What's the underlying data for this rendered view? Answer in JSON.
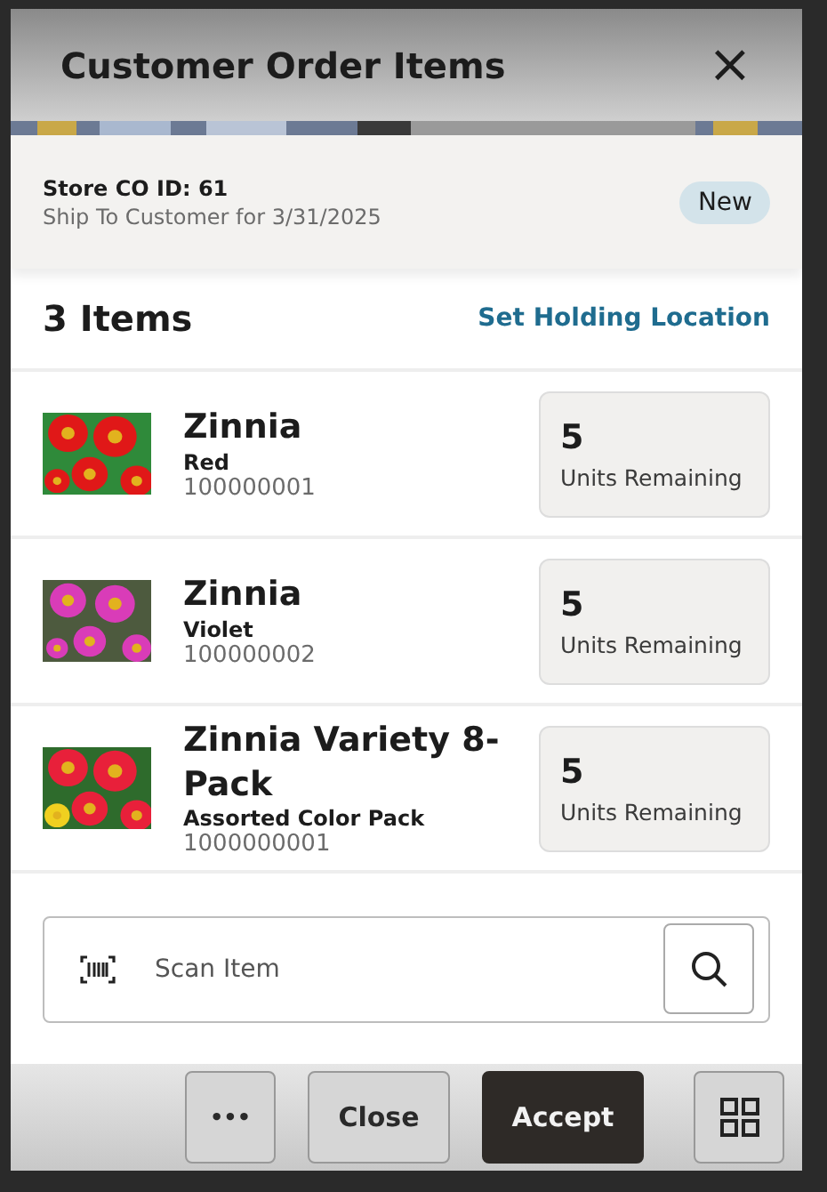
{
  "window": {
    "title": "Customer Order Items",
    "close": "×"
  },
  "order": {
    "id_label": "Store CO ID: 61",
    "subtitle": "Ship To Customer for 3/31/2025",
    "status": "New"
  },
  "items_header": {
    "count": "3 Items",
    "action": "Set Holding Location"
  },
  "items": [
    {
      "name": "Zinnia",
      "variant": "Red",
      "sku": "100000001",
      "quantity": "5",
      "quantity_label": "Units Remaining"
    },
    {
      "name": "Zinnia",
      "variant": "Violet",
      "sku": "100000002",
      "quantity": "5",
      "quantity_label": "Units Remaining"
    },
    {
      "name": "Zinnia Variety 8-Pack",
      "variant": "Assorted Color Pack",
      "sku": "1000000001",
      "quantity": "5",
      "quantity_label": "Units Remaining"
    }
  ],
  "scan": {
    "placeholder": "Scan Item"
  },
  "footer": {
    "buttons": [
      {
        "kind": "more",
        "label": "•••"
      },
      {
        "kind": "plain",
        "label": "Close"
      },
      {
        "kind": "primary",
        "label": "Accept"
      },
      {
        "kind": "grid"
      }
    ]
  }
}
